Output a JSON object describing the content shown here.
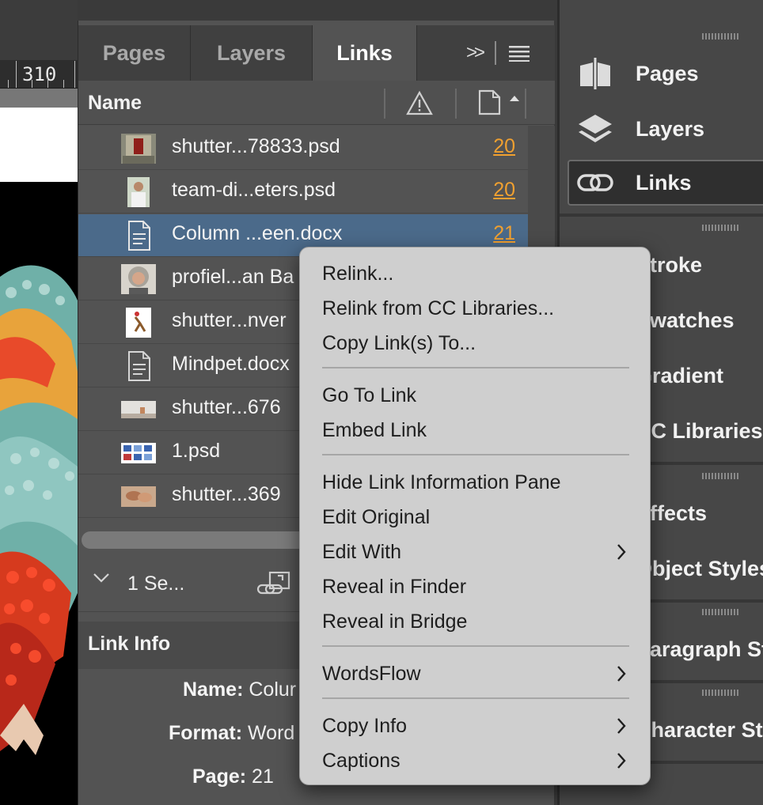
{
  "canvas": {
    "ruler_label": "310"
  },
  "links_panel": {
    "tabs": [
      "Pages",
      "Layers",
      "Links"
    ],
    "active_tab": "Links",
    "columns": {
      "name": "Name"
    },
    "rows": [
      {
        "name": "shutter...78833.psd",
        "page": "20",
        "thumb": "image-thumb-red-door"
      },
      {
        "name": "team-di...eters.psd",
        "page": "20",
        "thumb": "image-thumb-person"
      },
      {
        "name": "Column ...een.docx",
        "page": "21",
        "thumb": "document-icon",
        "selected": true
      },
      {
        "name": "profiel...an Ba",
        "page": "",
        "thumb": "image-thumb-portrait"
      },
      {
        "name": "shutter...nver",
        "page": "",
        "thumb": "image-thumb-illustration"
      },
      {
        "name": "Mindpet.docx",
        "page": "",
        "thumb": "document-icon"
      },
      {
        "name": "shutter...676",
        "page": "",
        "thumb": "image-thumb-landscape"
      },
      {
        "name": "1.psd",
        "page": "",
        "thumb": "image-thumb-chart"
      },
      {
        "name": "shutter...369",
        "page": "",
        "thumb": "image-thumb-hands"
      }
    ],
    "status": {
      "text": "1 Se..."
    },
    "link_info": {
      "title": "Link Info",
      "name_label": "Name:",
      "name_value": "Colur",
      "format_label": "Format:",
      "format_value": "Word",
      "page_label": "Page:",
      "page_value": "21"
    }
  },
  "dock": {
    "items": [
      {
        "label": "Pages",
        "icon": "pages-icon"
      },
      {
        "label": "Layers",
        "icon": "layers-icon"
      },
      {
        "label": "Links",
        "icon": "links-icon",
        "active": true
      },
      {
        "label": "Stroke"
      },
      {
        "label": "Swatches"
      },
      {
        "label": "Gradient"
      },
      {
        "label": "CC Libraries"
      },
      {
        "label": "Effects"
      },
      {
        "label": "Object Styles"
      },
      {
        "label": "Paragraph St"
      },
      {
        "label": "Character St"
      }
    ]
  },
  "context_menu": {
    "items": [
      {
        "label": "Relink..."
      },
      {
        "label": "Relink from CC Libraries..."
      },
      {
        "label": "Copy Link(s) To..."
      },
      {
        "label": "Go To Link"
      },
      {
        "label": "Embed Link"
      },
      {
        "label": "Hide Link Information Pane"
      },
      {
        "label": "Edit Original"
      },
      {
        "label": "Edit With",
        "submenu": true
      },
      {
        "label": "Reveal in Finder"
      },
      {
        "label": "Reveal in Bridge"
      },
      {
        "label": "WordsFlow",
        "submenu": true
      },
      {
        "label": "Copy Info",
        "submenu": true
      },
      {
        "label": "Captions",
        "submenu": true
      }
    ]
  },
  "colors": {
    "page_number": "#f0a030",
    "selection": "#4b6a8a",
    "menu_bg": "#cfcfcf"
  }
}
